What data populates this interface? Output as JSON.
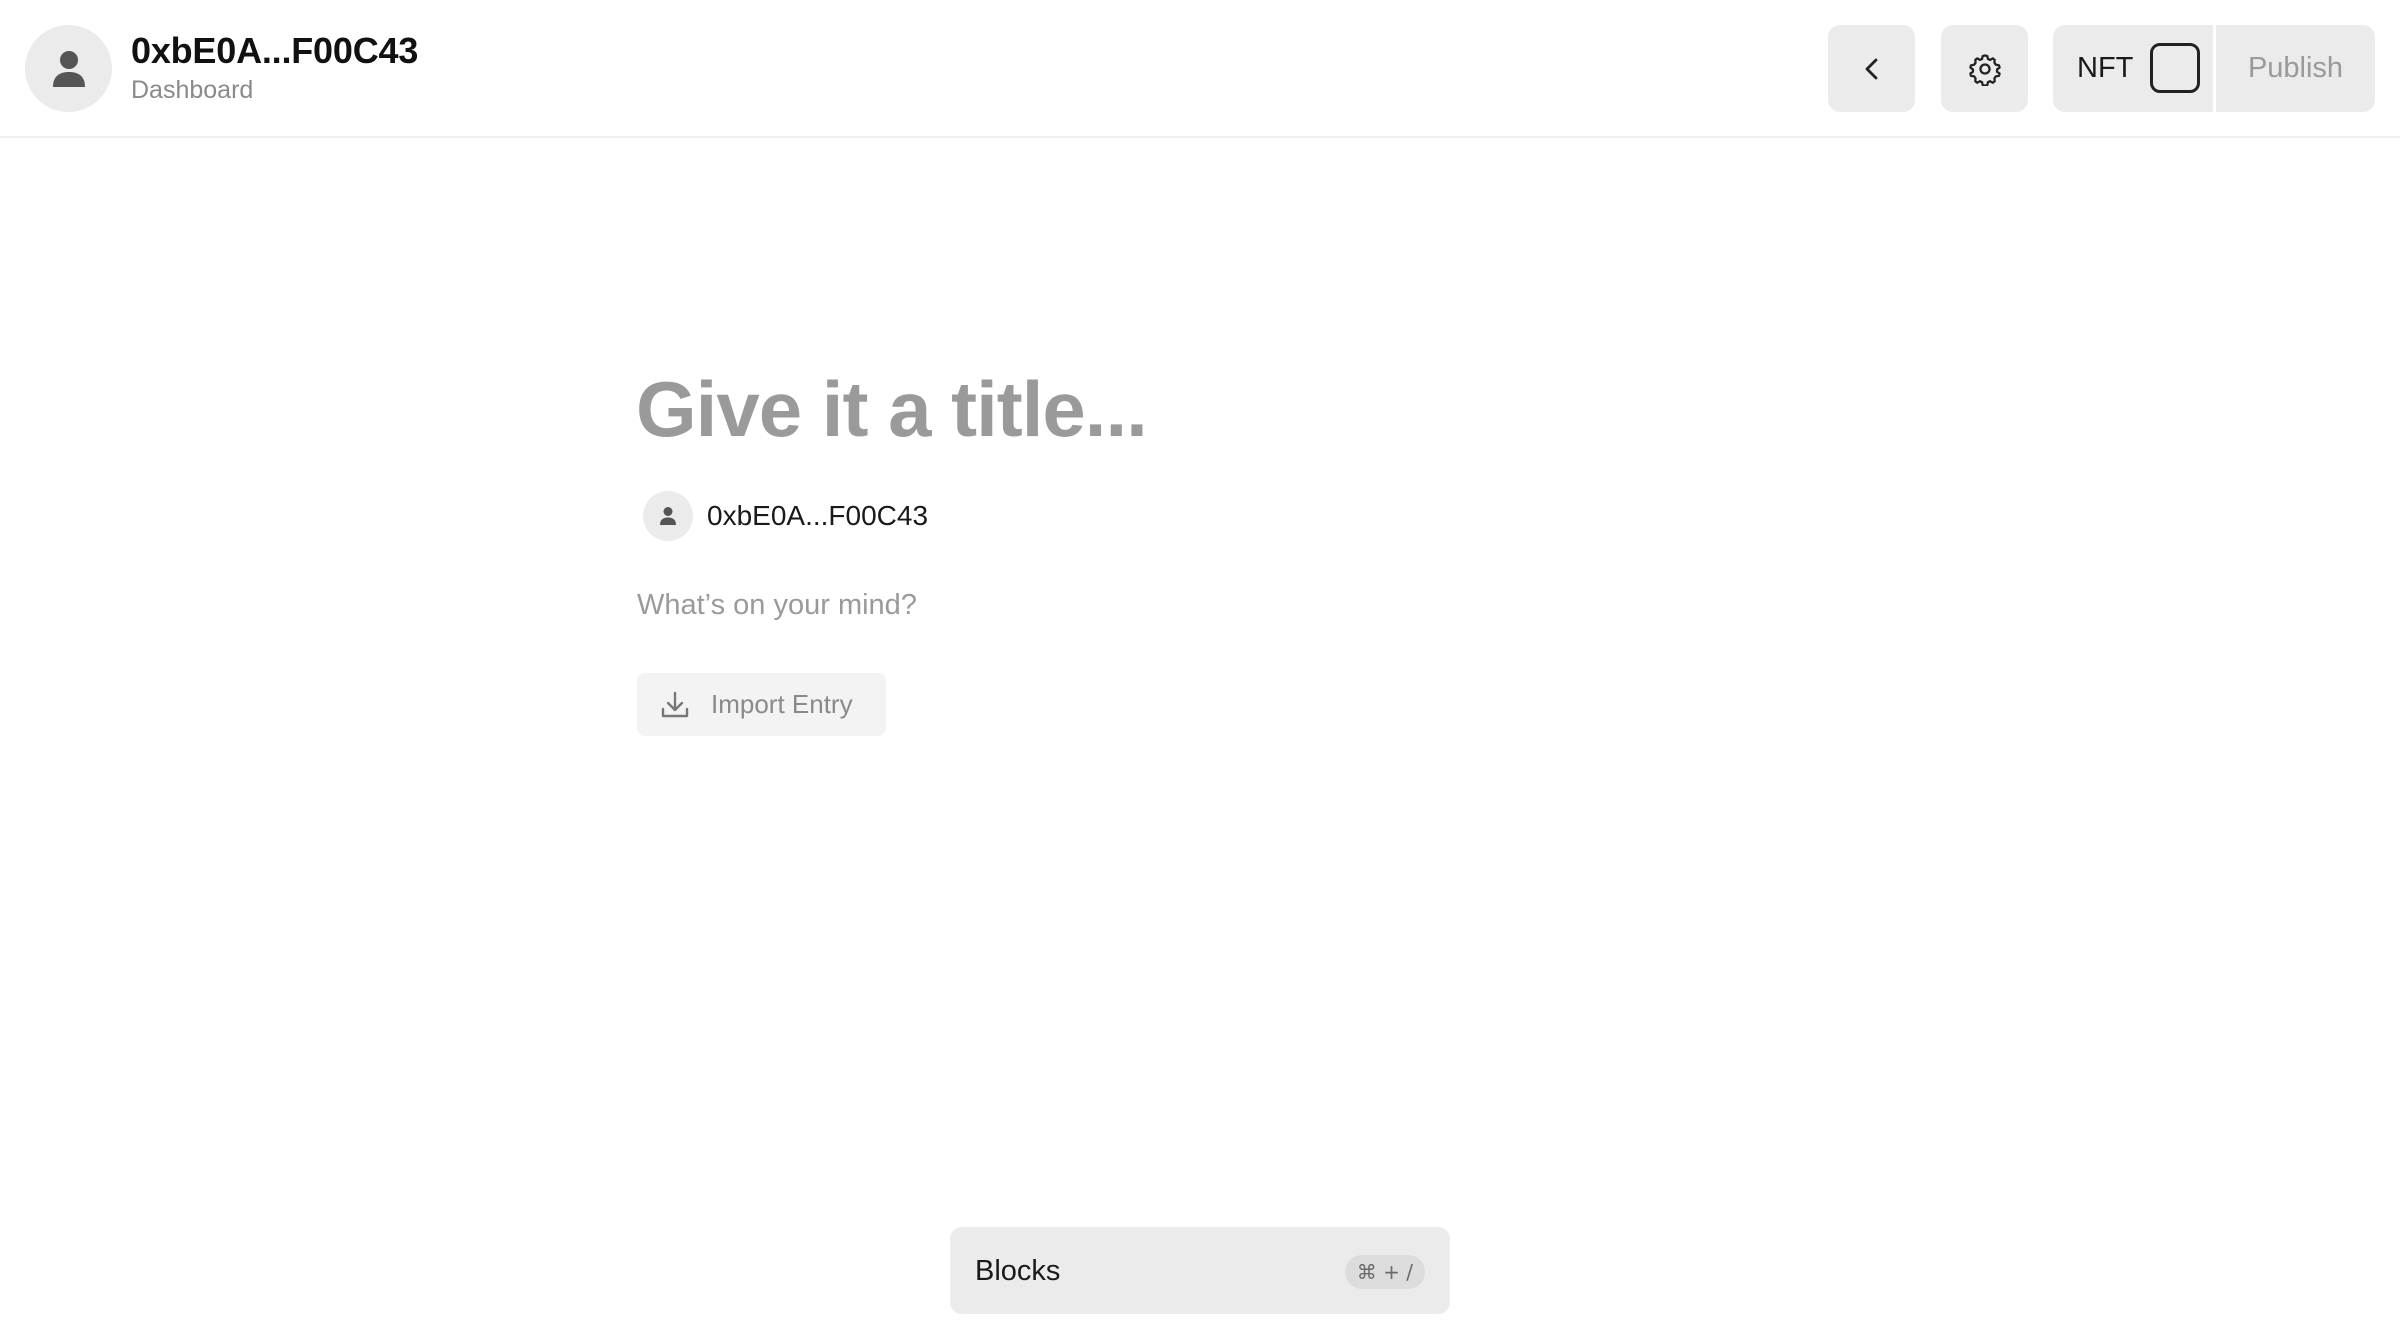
{
  "header": {
    "account_name": "0xbE0A...F00C43",
    "subtitle": "Dashboard",
    "avatar_icon": "user-icon",
    "back_icon": "chevron-left-icon",
    "settings_icon": "gear-icon",
    "nft_label": "NFT",
    "nft_checked": false,
    "publish_label": "Publish"
  },
  "editor": {
    "title_placeholder": "Give it a title...",
    "author_name": "0xbE0A...F00C43",
    "author_icon": "user-icon",
    "body_placeholder": "What’s on your mind?",
    "import_label": "Import Entry",
    "import_icon": "download-icon"
  },
  "blocks": {
    "label": "Blocks",
    "shortcut": "⌘ + /"
  },
  "colors": {
    "button_bg": "#ebebeb",
    "muted_text": "#9a9a9a",
    "primary_text": "#111111"
  }
}
